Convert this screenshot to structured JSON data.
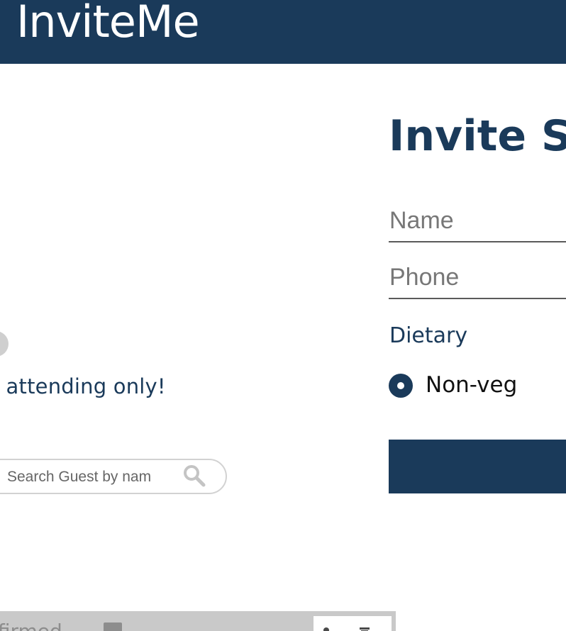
{
  "header": {
    "brand": "InviteMe"
  },
  "guest_list": {
    "filter_label": "r attending only!",
    "search": {
      "placeholder": "Search Guest by nam"
    },
    "row": {
      "status": "onfirmed"
    }
  },
  "invite_form": {
    "title": "Invite So",
    "name_placeholder": "Name",
    "phone_placeholder": "Phone",
    "dietary_label": "Dietary",
    "dietary_option": "Non-veg"
  },
  "colors": {
    "primary": "#1a3a5a",
    "muted": "#c9c9c9"
  }
}
